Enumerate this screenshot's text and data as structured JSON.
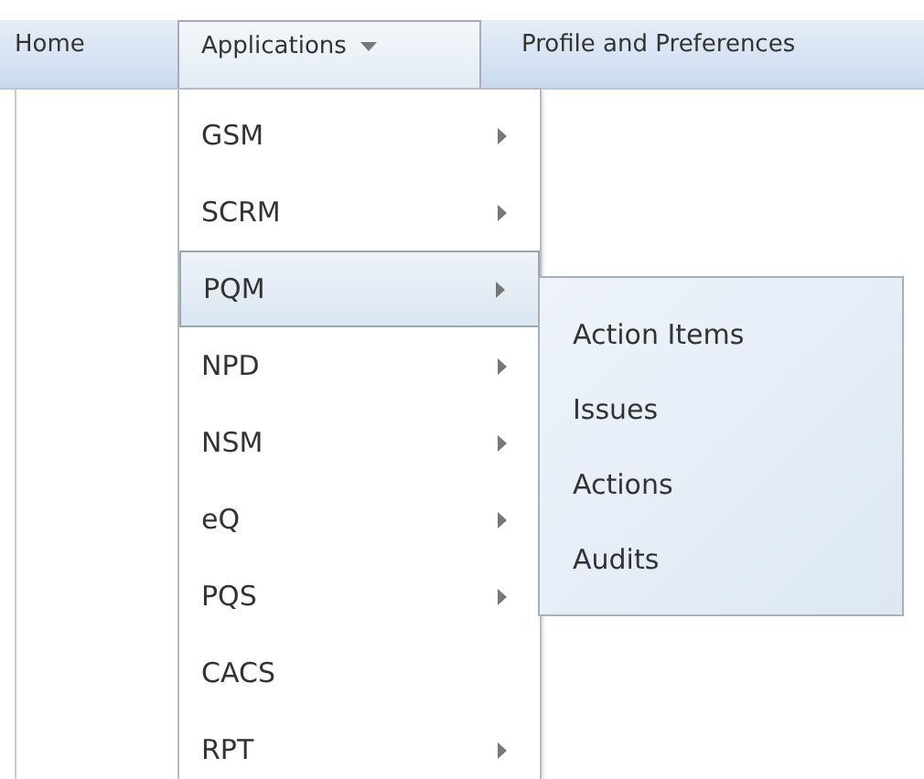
{
  "nav": [
    {
      "label": "Home",
      "selected": false,
      "dropdown": false
    },
    {
      "label": "Applications",
      "selected": true,
      "dropdown": true
    },
    {
      "label": "Profile and Preferences",
      "selected": false,
      "dropdown": false
    }
  ],
  "menu": [
    {
      "label": "GSM",
      "submenu": true,
      "selected": false
    },
    {
      "label": "SCRM",
      "submenu": true,
      "selected": false
    },
    {
      "label": "PQM",
      "submenu": true,
      "selected": true
    },
    {
      "label": "NPD",
      "submenu": true,
      "selected": false
    },
    {
      "label": "NSM",
      "submenu": true,
      "selected": false
    },
    {
      "label": "eQ",
      "submenu": true,
      "selected": false
    },
    {
      "label": "PQS",
      "submenu": true,
      "selected": false
    },
    {
      "label": "CACS",
      "submenu": false,
      "selected": false
    },
    {
      "label": "RPT",
      "submenu": true,
      "selected": false
    }
  ],
  "submenu": [
    "Action Items",
    "Issues",
    "Actions",
    "Audits"
  ]
}
